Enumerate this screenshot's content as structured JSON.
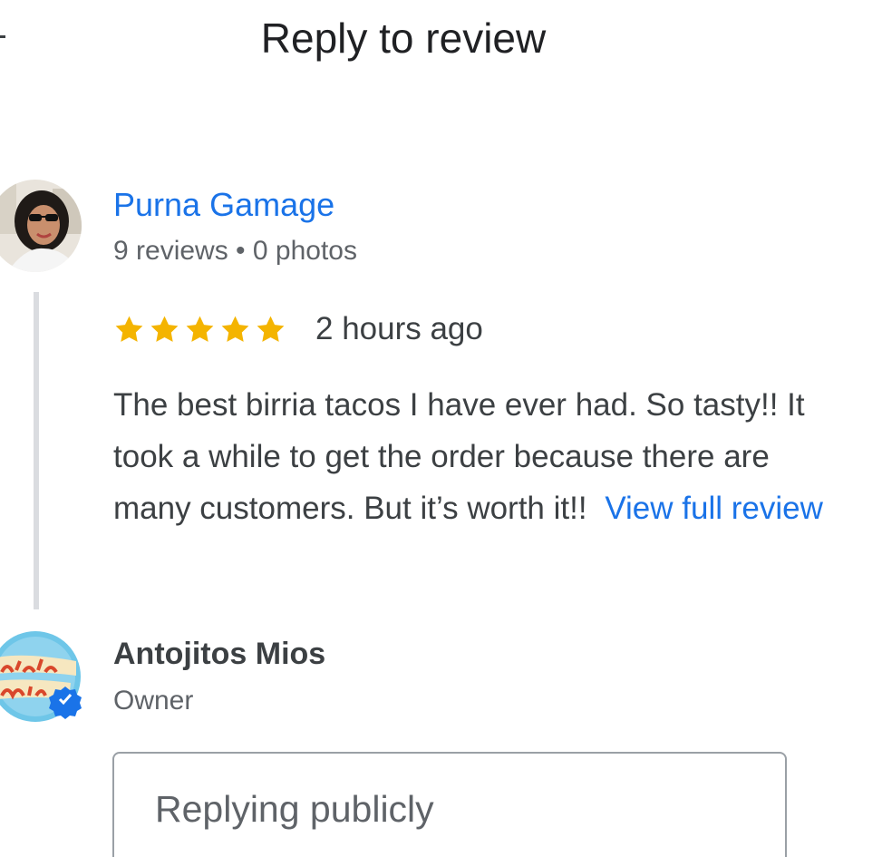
{
  "header": {
    "title": "Reply to review",
    "back_icon": "back-arrow-icon"
  },
  "review": {
    "reviewer_name": "Purna Gamage",
    "reviewer_meta": "9 reviews • 0 photos",
    "rating": 5,
    "rating_max": 5,
    "star_color": "#f4b400",
    "time": "2 hours ago",
    "text": "The best birria tacos I have ever had. So tasty!! It took a while to get the order because there are many customers. But it’s worth it!!",
    "view_full_label": "View full review"
  },
  "owner": {
    "name": "Antojitos Mios",
    "role": "Owner",
    "verified_icon": "verified-badge-icon"
  },
  "reply": {
    "placeholder": "Replying publicly"
  },
  "colors": {
    "link": "#1a73e8",
    "text": "#3c4043",
    "secondary": "#5f6368"
  }
}
